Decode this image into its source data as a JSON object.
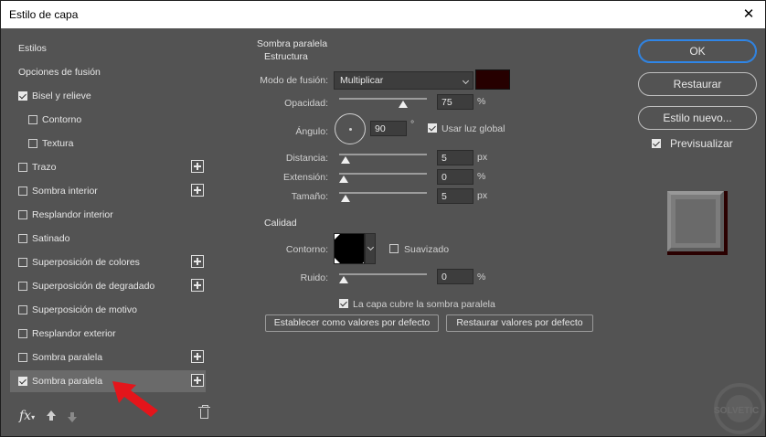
{
  "window": {
    "title": "Estilo de capa"
  },
  "left": {
    "items": [
      {
        "label": "Estilos",
        "checkbox": false,
        "plus": false
      },
      {
        "label": "Opciones de fusión",
        "checkbox": false,
        "plus": false
      },
      {
        "label": "Bisel y relieve",
        "checkbox": true,
        "checked": true,
        "plus": false
      },
      {
        "label": "Contorno",
        "checkbox": true,
        "checked": false,
        "plus": false,
        "indent": true
      },
      {
        "label": "Textura",
        "checkbox": true,
        "checked": false,
        "plus": false,
        "indent": true
      },
      {
        "label": "Trazo",
        "checkbox": true,
        "checked": false,
        "plus": true
      },
      {
        "label": "Sombra interior",
        "checkbox": true,
        "checked": false,
        "plus": true
      },
      {
        "label": "Resplandor interior",
        "checkbox": true,
        "checked": false,
        "plus": false
      },
      {
        "label": "Satinado",
        "checkbox": true,
        "checked": false,
        "plus": false
      },
      {
        "label": "Superposición de colores",
        "checkbox": true,
        "checked": false,
        "plus": true
      },
      {
        "label": "Superposición de degradado",
        "checkbox": true,
        "checked": false,
        "plus": true
      },
      {
        "label": "Superposición de motivo",
        "checkbox": true,
        "checked": false,
        "plus": false
      },
      {
        "label": "Resplandor exterior",
        "checkbox": true,
        "checked": false,
        "plus": false
      },
      {
        "label": "Sombra paralela",
        "checkbox": true,
        "checked": false,
        "plus": true
      },
      {
        "label": "Sombra paralela",
        "checkbox": true,
        "checked": true,
        "plus": true,
        "selected": true
      }
    ],
    "fx_label": "fx"
  },
  "panel": {
    "section_title": "Sombra paralela",
    "subsection_title": "Estructura",
    "blend_mode": {
      "label": "Modo de fusión:",
      "value": "Multiplicar"
    },
    "shadow_color": "#260000",
    "opacity": {
      "label": "Opacidad:",
      "value": "75",
      "unit": "%",
      "level": 0.75
    },
    "angle": {
      "label": "Ángulo:",
      "value": "90",
      "unit": "°",
      "global_light_label": "Usar luz global",
      "global_light_checked": true
    },
    "distance": {
      "label": "Distancia:",
      "value": "5",
      "unit": "px",
      "level": 0.02
    },
    "spread": {
      "label": "Extensión:",
      "value": "0",
      "unit": "%",
      "level": 0.0
    },
    "size": {
      "label": "Tamaño:",
      "value": "5",
      "unit": "px",
      "level": 0.02
    },
    "quality_title": "Calidad",
    "contour": {
      "label": "Contorno:",
      "antialias_label": "Suavizado",
      "antialias_checked": false
    },
    "noise": {
      "label": "Ruido:",
      "value": "0",
      "unit": "%",
      "level": 0.0
    },
    "knockout_label": "La capa cubre la sombra paralela",
    "knockout_checked": true,
    "make_default_label": "Establecer como valores por defecto",
    "reset_default_label": "Restaurar valores por defecto"
  },
  "right": {
    "ok_label": "OK",
    "reset_label": "Restaurar",
    "new_style_label": "Estilo nuevo...",
    "preview_label": "Previsualizar",
    "preview_checked": true
  },
  "watermark": {
    "line1": "SOLVETIC",
    "line2": "SOLUCIONES"
  }
}
